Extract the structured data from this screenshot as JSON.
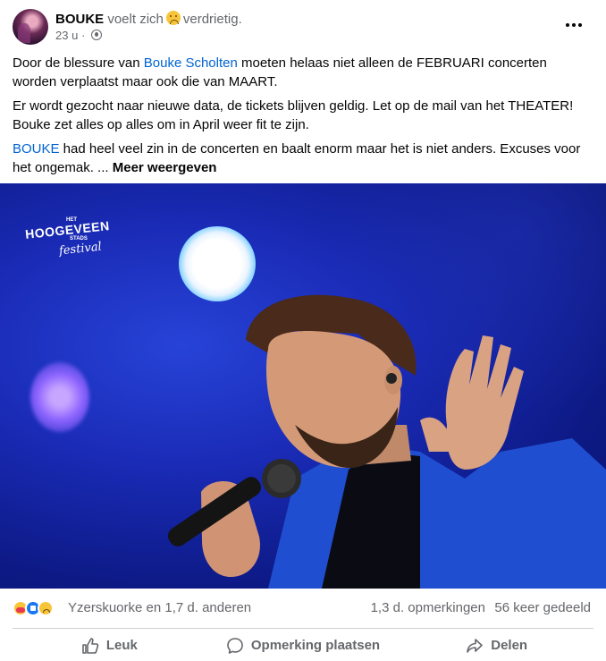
{
  "header": {
    "author": "BOUKE",
    "feeling_prefix": "voelt zich",
    "feeling": "verdrietig.",
    "time": "23 u",
    "separator": "·"
  },
  "post": {
    "p1_a": "Door de blessure van ",
    "p1_link": "Bouke Scholten",
    "p1_b": " moeten helaas niet alleen de FEBRUARI concerten worden verplaatst maar ook die van MAART.",
    "p2": "Er wordt gezocht naar nieuwe data, de tickets blijven geldig. Let op de mail van het THEATER! Bouke zet alles op alles om in April weer fit te zijn.",
    "p3_link": "BOUKE",
    "p3_b": " had heel veel zin in de concerten en baalt enorm maar het is niet anders. Excuses voor het ongemak. ... ",
    "see_more": "Meer weergeven"
  },
  "photo": {
    "logo_top": "HET",
    "logo_main": "HOOGEVEEN",
    "logo_sub": "STADS",
    "logo_script": "festival"
  },
  "stats": {
    "reactions": [
      "care-icon",
      "like-icon",
      "sad-icon"
    ],
    "reactors": "Yzerskuorke en 1,7 d. anderen",
    "comments": "1,3 d. opmerkingen",
    "shares": "56 keer gedeeld"
  },
  "actions": {
    "like": "Leuk",
    "comment": "Opmerking plaatsen",
    "share": "Delen"
  },
  "colors": {
    "link": "#0064d1",
    "secondary_text": "#65676b",
    "like_blue": "#1877f2"
  }
}
